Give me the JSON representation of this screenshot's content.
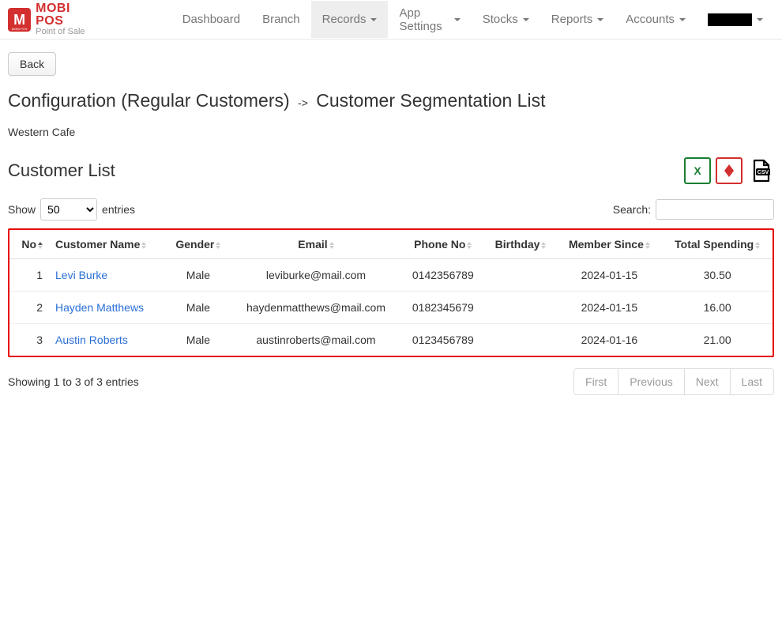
{
  "brand": {
    "main": "MOBI POS",
    "sub": "Point of Sale",
    "logo_letter": "M",
    "logo_sub": "MOBI POS"
  },
  "nav": [
    {
      "label": "Dashboard",
      "dropdown": false,
      "active": false
    },
    {
      "label": "Branch",
      "dropdown": false,
      "active": false
    },
    {
      "label": "Records",
      "dropdown": true,
      "active": true
    },
    {
      "label": "App Settings",
      "dropdown": true,
      "active": false
    },
    {
      "label": "Stocks",
      "dropdown": true,
      "active": false
    },
    {
      "label": "Reports",
      "dropdown": true,
      "active": false
    },
    {
      "label": "Accounts",
      "dropdown": true,
      "active": false
    }
  ],
  "back_label": "Back",
  "breadcrumb": {
    "part1": "Configuration (Regular Customers)",
    "arrow": "->",
    "part2": "Customer Segmentation List"
  },
  "venue": "Western Cafe",
  "list_title": "Customer List",
  "show_label": "Show",
  "entries_label": "entries",
  "entries_value": "50",
  "search_label": "Search:",
  "search_value": "",
  "columns": {
    "no": "No",
    "name": "Customer Name",
    "gender": "Gender",
    "email": "Email",
    "phone": "Phone No",
    "birthday": "Birthday",
    "member_since": "Member Since",
    "total_spending": "Total Spending"
  },
  "rows": [
    {
      "no": "1",
      "name": "Levi Burke",
      "gender": "Male",
      "email": "leviburke@mail.com",
      "phone": "0142356789",
      "birthday": "",
      "member_since": "2024-01-15",
      "total_spending": "30.50"
    },
    {
      "no": "2",
      "name": "Hayden Matthews",
      "gender": "Male",
      "email": "haydenmatthews@mail.com",
      "phone": "0182345679",
      "birthday": "",
      "member_since": "2024-01-15",
      "total_spending": "16.00"
    },
    {
      "no": "3",
      "name": "Austin Roberts",
      "gender": "Male",
      "email": "austinroberts@mail.com",
      "phone": "0123456789",
      "birthday": "",
      "member_since": "2024-01-16",
      "total_spending": "21.00"
    }
  ],
  "footer_info": "Showing 1 to 3 of 3 entries",
  "pager": {
    "first": "First",
    "previous": "Previous",
    "next": "Next",
    "last": "Last"
  }
}
